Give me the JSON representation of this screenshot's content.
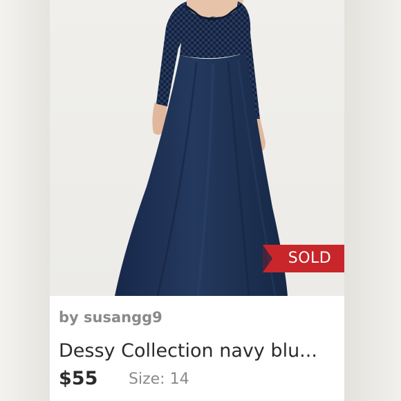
{
  "listing": {
    "seller": "by susangg9",
    "title": "Dessy Collection navy blu...",
    "price": "$55",
    "size": "Size: 14",
    "badge": "SOLD"
  },
  "colors": {
    "badge_red": "#c8262b",
    "navy_dress": "#1e3252",
    "text_dark": "#2b2b2b",
    "text_muted": "#8a8a8a"
  }
}
